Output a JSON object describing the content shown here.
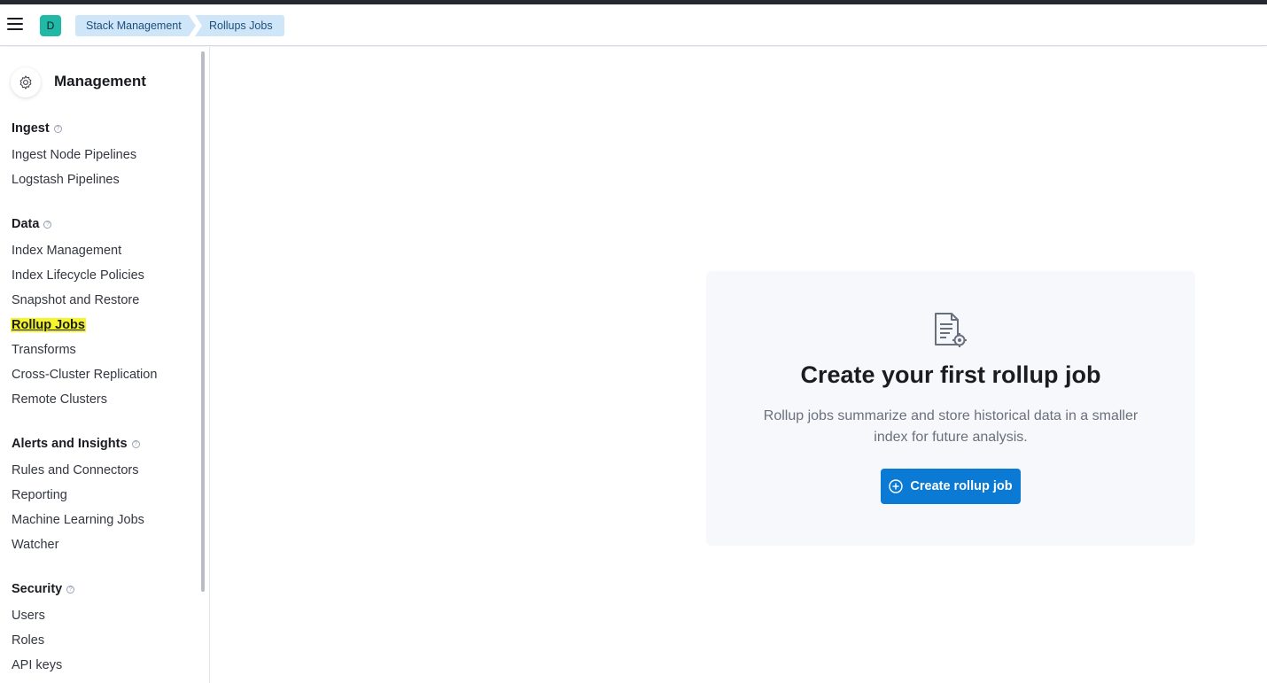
{
  "header": {
    "avatar_initial": "D",
    "breadcrumbs": [
      "Stack Management",
      "Rollups Jobs"
    ]
  },
  "sidebar": {
    "title": "Management",
    "groups": [
      {
        "title": "Ingest",
        "items": [
          "Ingest Node Pipelines",
          "Logstash Pipelines"
        ]
      },
      {
        "title": "Data",
        "items": [
          "Index Management",
          "Index Lifecycle Policies",
          "Snapshot and Restore",
          "Rollup Jobs",
          "Transforms",
          "Cross-Cluster Replication",
          "Remote Clusters"
        ]
      },
      {
        "title": "Alerts and Insights",
        "items": [
          "Rules and Connectors",
          "Reporting",
          "Machine Learning Jobs",
          "Watcher"
        ]
      },
      {
        "title": "Security",
        "items": [
          "Users",
          "Roles",
          "API keys"
        ]
      }
    ],
    "active_item": "Rollup Jobs"
  },
  "empty_state": {
    "title": "Create your first rollup job",
    "description": "Rollup jobs summarize and store historical data in a smaller index for future analysis.",
    "button_label": "Create rollup job",
    "icon": "document-gear-icon"
  },
  "colors": {
    "accent": "#0b7ad4",
    "breadcrumb_bg": "#cfe5f8",
    "avatar_bg": "#1fb9a6",
    "highlight": "#f4f62a"
  }
}
